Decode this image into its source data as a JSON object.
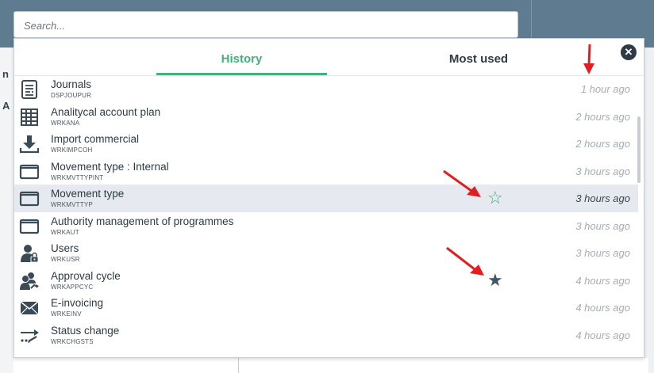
{
  "search": {
    "placeholder": "Search..."
  },
  "background": {
    "letter_1": "n",
    "letter_2": "A"
  },
  "tabs": [
    {
      "label": "History",
      "active": true
    },
    {
      "label": "Most used",
      "active": false
    }
  ],
  "close": {
    "icon": "close-icon",
    "glyph": "✕"
  },
  "items": [
    {
      "title": "Journals",
      "code": "DSPJOUPUR",
      "time": "1 hour ago",
      "icon": "journal-icon"
    },
    {
      "title": "Analitycal account plan",
      "code": "WRKANA",
      "time": "2 hours ago",
      "icon": "grid-icon"
    },
    {
      "title": "Import commercial",
      "code": "WRKIMPCOH",
      "time": "2 hours ago",
      "icon": "download-icon"
    },
    {
      "title": "Movement type : Internal",
      "code": "WRKMVTTYPINT",
      "time": "3 hours ago",
      "icon": "window-icon"
    },
    {
      "title": "Movement type",
      "code": "WRKMVTTYP",
      "time": "3 hours ago",
      "icon": "window-icon",
      "highlighted": true,
      "favorite": "outline"
    },
    {
      "title": "Authority management of programmes",
      "code": "WRKAUT",
      "time": "3 hours ago",
      "icon": "window-icon"
    },
    {
      "title": "Users",
      "code": "WRKUSR",
      "time": "3 hours ago",
      "icon": "user-lock-icon"
    },
    {
      "title": "Approval cycle",
      "code": "WRKAPPCYC",
      "time": "4 hours ago",
      "icon": "users-approval-icon",
      "favorite": "filled"
    },
    {
      "title": "E-invoicing",
      "code": "WRKEINV",
      "time": "4 hours ago",
      "icon": "envelope-icon"
    },
    {
      "title": "Status change",
      "code": "WRKCHGSTS",
      "time": "4 hours ago",
      "icon": "status-change-icon"
    }
  ],
  "stars": {
    "outline": "☆",
    "filled": "★"
  },
  "colors": {
    "accent": "#3db47a",
    "header": "#5f7b90",
    "dark": "#2f3b44",
    "annotation": "#e02020"
  }
}
